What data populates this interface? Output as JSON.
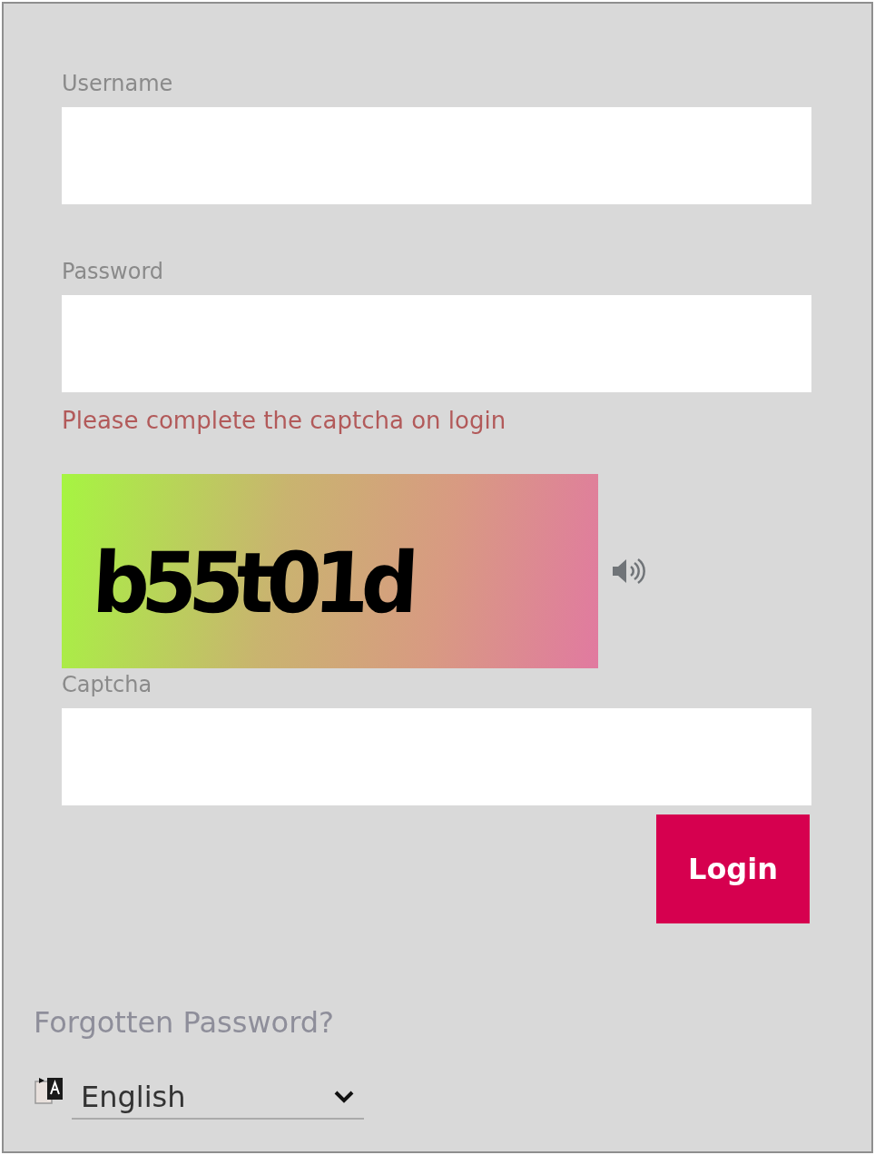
{
  "fields": [
    {
      "label": "Username"
    },
    {
      "label": "Password"
    }
  ],
  "error": "Please complete the captcha on login",
  "captcha": {
    "code": "b55t01d",
    "field": {
      "label": "Captcha"
    }
  },
  "login_button": "Login",
  "forgot_link": "Forgotten Password?",
  "language": {
    "value": "English"
  }
}
